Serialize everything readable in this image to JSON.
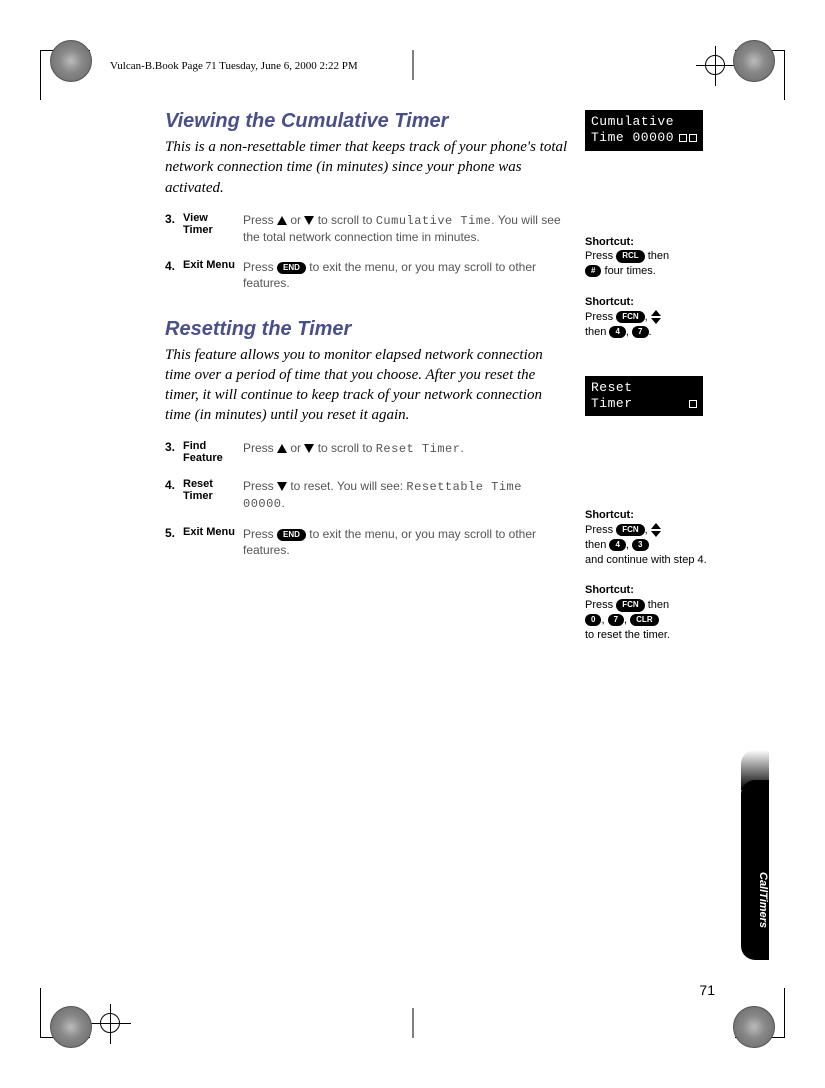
{
  "header": "Vulcan-B.Book  Page 71  Tuesday, June 6, 2000  2:22 PM",
  "page_number": "71",
  "tab_label": "CallTimers",
  "section1": {
    "title": "Viewing the Cumulative Timer",
    "intro": "This is a non-resettable timer that keeps track of your phone's total network connection time (in minutes) since your phone was activated.",
    "lcd": {
      "line1": "Cumulative",
      "line2": "Time 00000"
    },
    "steps": [
      {
        "num": "3.",
        "label": "View Timer",
        "pre": "Press ",
        "mid": " or ",
        "post1": " to scroll to ",
        "code": "Cumulative Time",
        "post2": ". You will see the total network connection time in minutes."
      },
      {
        "num": "4.",
        "label": "Exit Menu",
        "pre": "Press ",
        "post": " to exit the menu, or you may scroll to other features."
      }
    ],
    "shortcuts": [
      {
        "title": "Shortcut:",
        "l1a": "Press ",
        "key1": "RCL",
        "l1b": " then",
        "l2key": "#",
        "l2b": " four times."
      },
      {
        "title": "Shortcut:",
        "l1a": "Press ",
        "key1": "FCN",
        "l1b": ", ",
        "l2a": "then ",
        "k2": "4",
        "k3": "7",
        "l2b": "."
      }
    ]
  },
  "section2": {
    "title": "Resetting the Timer",
    "intro": "This feature allows you to monitor elapsed network connection time over a period of time that you choose. After you reset the timer, it will continue to keep track of your network connection time (in minutes) until you reset it again.",
    "lcd": {
      "line1": "Reset",
      "line2": "Timer"
    },
    "steps": [
      {
        "num": "3.",
        "label": "Find Feature",
        "pre": "Press ",
        "mid": " or ",
        "post1": " to scroll to ",
        "code": "Reset Timer",
        "post2": "."
      },
      {
        "num": "4.",
        "label": "Reset Timer",
        "pre": "Press ",
        "post1": " to reset. You will see: ",
        "code": "Resettable Time 00000",
        "post2": "."
      },
      {
        "num": "5.",
        "label": "Exit Menu",
        "pre": "Press ",
        "post": " to exit the menu, or you may scroll to other features."
      }
    ],
    "shortcuts": [
      {
        "title": "Shortcut:",
        "l1a": "Press ",
        "key1": "FCN",
        "l1b": ", ",
        "l2a": "then ",
        "k2": "4",
        "l2c": ", ",
        "k3": "3",
        "l3": "and continue with step 4."
      },
      {
        "title": "Shortcut:",
        "l1a": "Press ",
        "key1": "FCN",
        "l1b": " then",
        "k2": "0",
        "k3": "7",
        "k4": "CLR",
        "l3": "to reset the timer."
      }
    ]
  }
}
